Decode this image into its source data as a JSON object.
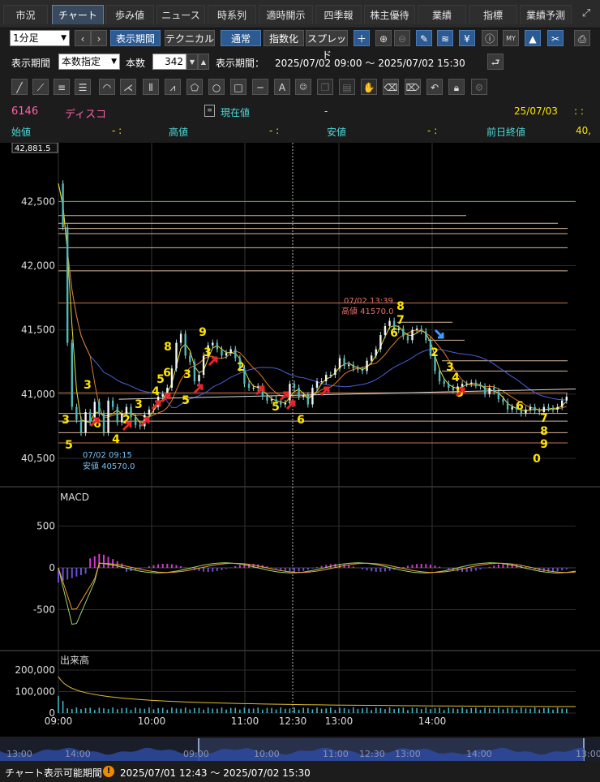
{
  "tabs": [
    "市況",
    "チャート",
    "歩み値",
    "ニュース",
    "時系列",
    "適時開示",
    "四季報",
    "株主優待",
    "業績",
    "指標",
    "業績予測"
  ],
  "toolbar": {
    "interval": "1分足",
    "prev": "‹",
    "next": "›",
    "display_period": "表示期間",
    "technical": "テクニカル",
    "normal": "通常",
    "index": "指数化",
    "spread": "スプレッド"
  },
  "period_row": {
    "label": "表示期間",
    "mode": "本数指定",
    "count_label": "本数",
    "count": "342",
    "range_label": "表示期間：",
    "range": "2025/07/02 09:00 〜 2025/07/02 15:30"
  },
  "quote": {
    "code": "6146",
    "name": "ディスコ",
    "current_label": "現在値",
    "current_value": "-",
    "date": "25/07/03",
    "time": ":   :",
    "open_label": "始値",
    "open_value": "-   :",
    "high_label": "高値",
    "high_value": "-   :",
    "low_label": "安値",
    "low_value": "-   :",
    "prev_close_label": "前日終値",
    "prev_close_value": "40,"
  },
  "chart_data": {
    "type": "line",
    "title": "",
    "price_axis": [
      "42,500",
      "42,000",
      "41,500",
      "41,000",
      "40,500"
    ],
    "price_ticks": [
      42500,
      42000,
      41500,
      41000,
      40500
    ],
    "ylim": [
      40500,
      42881.5
    ],
    "top_value_label": "42,881.5",
    "time_axis": [
      "09:00",
      "10:00",
      "11:00",
      "12:30",
      "13:00",
      "14:00"
    ],
    "price_series": {
      "t": [
        0,
        3,
        6,
        9,
        12,
        15,
        18,
        21,
        24,
        27,
        30,
        33,
        36,
        39,
        42,
        45,
        48,
        51,
        54,
        57,
        60,
        63,
        66,
        69,
        72,
        75,
        78,
        81,
        84,
        87,
        90,
        93,
        96,
        99,
        102,
        105,
        108,
        111,
        114,
        117,
        120,
        123,
        126,
        129,
        132,
        135,
        138,
        141,
        144,
        147,
        150,
        153,
        156,
        159,
        162,
        165,
        168,
        171,
        174,
        177,
        180,
        183,
        186,
        189,
        192,
        195,
        198,
        201,
        204,
        207,
        210,
        213,
        216,
        219,
        222,
        225,
        228,
        231,
        234,
        237,
        240,
        243,
        246,
        249,
        252,
        255,
        258,
        261,
        264,
        267,
        270,
        273,
        276,
        279,
        282,
        285,
        288,
        291,
        294,
        297,
        300,
        303,
        306,
        309,
        312,
        315,
        318,
        321,
        324,
        327,
        330,
        333,
        336,
        339,
        342
      ],
      "y": [
        42640,
        42300,
        41400,
        40900,
        40800,
        40700,
        40860,
        40780,
        40940,
        40850,
        40700,
        40950,
        40900,
        40780,
        40850,
        40900,
        40820,
        40760,
        40750,
        40840,
        40880,
        40900,
        40980,
        41000,
        41050,
        41200,
        41400,
        41470,
        41300,
        41250,
        41100,
        41150,
        41300,
        41380,
        41400,
        41350,
        41300,
        41320,
        41350,
        41280,
        41200,
        41080,
        41050,
        41050,
        41060,
        40980,
        40950,
        40960,
        40940,
        40920,
        40930,
        41080,
        41050,
        40980,
        40990,
        40920,
        41050,
        41100,
        41100,
        41150,
        41150,
        41200,
        41280,
        41220,
        41230,
        41200,
        41190,
        41180,
        41260,
        41300,
        41350,
        41460,
        41530,
        41570,
        41500,
        41510,
        41450,
        41420,
        41500,
        41510,
        41490,
        41420,
        41300,
        41180,
        41100,
        41080,
        41050,
        41030,
        41060,
        41080,
        41080,
        41090,
        41070,
        41060,
        41000,
        41050,
        41020,
        40960,
        40940,
        40880,
        40900,
        40880,
        40850,
        40880,
        40900,
        40870,
        40860,
        40900,
        40890,
        40880,
        40900,
        40950,
        40980
      ]
    },
    "annotations": {
      "high": {
        "time": "07/02 13:39",
        "label": "高値",
        "value": "41570.0"
      },
      "low": {
        "time": "07/02 09:15",
        "label": "安値",
        "value": "40570.0"
      }
    },
    "count_labels": [
      "5",
      "3",
      "3",
      "6",
      "4",
      "2",
      "3",
      "4",
      "5",
      "6",
      "8",
      "9",
      "3",
      "3",
      "5",
      "2",
      "5",
      "6",
      "8",
      "7",
      "6",
      "2",
      "3",
      "4",
      "5",
      "6",
      "7",
      "8",
      "9",
      "0"
    ],
    "macd": {
      "label": "MACD",
      "axis": [
        "500",
        "0",
        "-500"
      ],
      "ticks": [
        500,
        0,
        -500
      ]
    },
    "volume": {
      "label": "出来高",
      "axis": [
        "200,000",
        "100,000",
        "0"
      ],
      "ticks": [
        200000,
        100000,
        0
      ]
    }
  },
  "overview": {
    "labels": [
      "13:00",
      "14:00",
      "09:00",
      "10:00",
      "11:00",
      "12:30",
      "13:00",
      "14:00",
      "13:00"
    ]
  },
  "status": {
    "label": "チャート表示可能期間",
    "range": "2025/07/01 12:43 〜 2025/07/02 15:30"
  },
  "colors": {
    "accent": "#2c5a92",
    "up_arrow": "#e8262a",
    "down_arrow": "#3f9bff",
    "count": "#ffe400",
    "green_line": "#33cc33",
    "ma_blue": "#4a5fd8",
    "ma_orange": "#e07a24",
    "ma_yellow": "#e8e032"
  },
  "icons": [
    "plus-icon",
    "zoom-in-icon",
    "zoom-out-icon",
    "pencil-icon",
    "wave-icon",
    "yen-icon",
    "info-icon",
    "my-icon",
    "area-chart-icon",
    "wrench-icon",
    "print-icon",
    "return-icon"
  ]
}
